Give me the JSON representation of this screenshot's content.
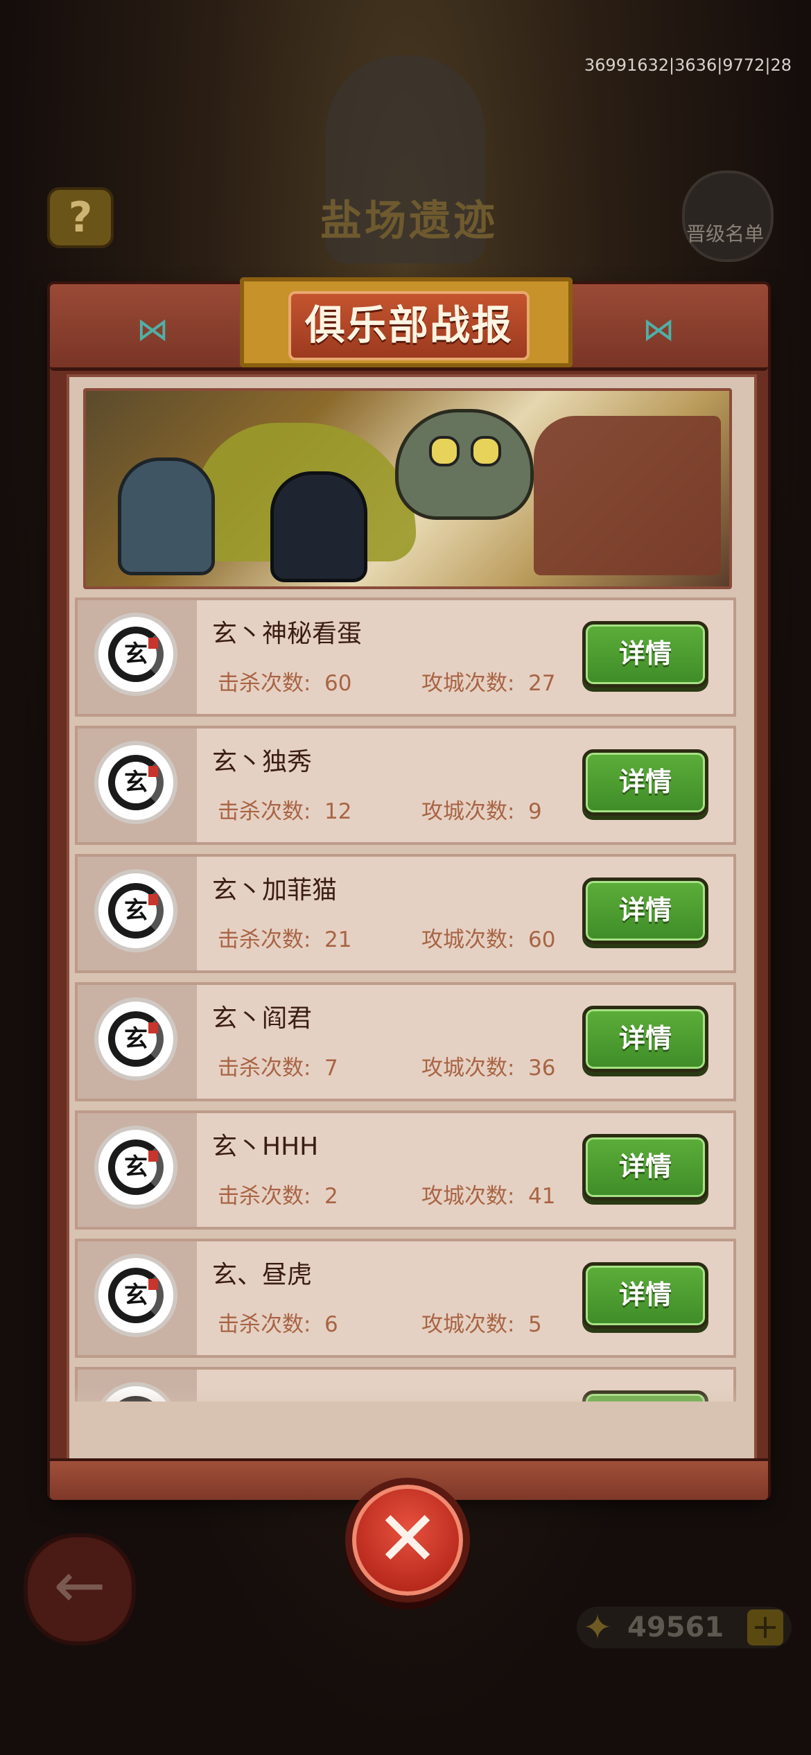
{
  "debug_id": "36991632|3636|9772|28",
  "background": {
    "title": "盐场遗迹",
    "help_label": "?",
    "promotion_label": "晋级名单",
    "currency_value": "49561",
    "currency_add": "+"
  },
  "panel": {
    "title": "俱乐部战报",
    "close_label": "✕"
  },
  "labels": {
    "kills": "击杀次数:",
    "sieges": "攻城次数:",
    "detail": "详情"
  },
  "members": [
    {
      "name": "玄丶神秘看蛋",
      "kills": "60",
      "sieges": "27",
      "avatar_char": "玄"
    },
    {
      "name": "玄丶独秀",
      "kills": "12",
      "sieges": "9",
      "avatar_char": "玄"
    },
    {
      "name": "玄丶加菲猫",
      "kills": "21",
      "sieges": "60",
      "avatar_char": "玄"
    },
    {
      "name": "玄丶阎君",
      "kills": "7",
      "sieges": "36",
      "avatar_char": "玄"
    },
    {
      "name": "玄丶HHH",
      "kills": "2",
      "sieges": "41",
      "avatar_char": "玄"
    },
    {
      "name": "玄、昼虎",
      "kills": "6",
      "sieges": "5",
      "avatar_char": "玄"
    },
    {
      "name": "",
      "kills": "",
      "sieges": "",
      "avatar_char": "玄"
    }
  ]
}
